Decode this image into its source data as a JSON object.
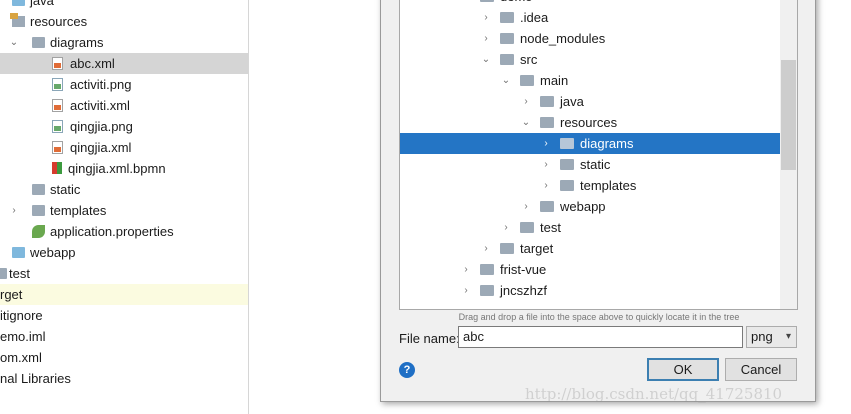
{
  "left_tree": {
    "rows": [
      {
        "label": "java",
        "icon": "folder-blue-icon",
        "arrow": ""
      },
      {
        "label": "resources",
        "icon": "resources-folder-icon",
        "arrow": ""
      },
      {
        "label": "diagrams",
        "icon": "folder-icon",
        "arrow": "⌄"
      },
      {
        "label": "abc.xml",
        "icon": "xml-file-icon",
        "arrow": ""
      },
      {
        "label": "activiti.png",
        "icon": "image-file-icon",
        "arrow": ""
      },
      {
        "label": "activiti.xml",
        "icon": "xml-file-icon",
        "arrow": ""
      },
      {
        "label": "qingjia.png",
        "icon": "image-file-icon",
        "arrow": ""
      },
      {
        "label": "qingjia.xml",
        "icon": "xml-file-icon",
        "arrow": ""
      },
      {
        "label": "qingjia.xml.bpmn",
        "icon": "bpmn-file-icon",
        "arrow": ""
      },
      {
        "label": "static",
        "icon": "folder-icon",
        "arrow": ""
      },
      {
        "label": "templates",
        "icon": "folder-icon",
        "arrow": "›"
      },
      {
        "label": "application.properties",
        "icon": "spring-leaf-icon",
        "arrow": ""
      },
      {
        "label": "webapp",
        "icon": "folder-blue-icon",
        "arrow": ""
      },
      {
        "label": "test",
        "icon": "folder-icon",
        "arrow": ""
      },
      {
        "label": "rget",
        "icon": "",
        "arrow": ""
      },
      {
        "label": "itignore",
        "icon": "",
        "arrow": ""
      },
      {
        "label": "emo.iml",
        "icon": "",
        "arrow": ""
      },
      {
        "label": "om.xml",
        "icon": "",
        "arrow": ""
      },
      {
        "label": "nal Libraries",
        "icon": "",
        "arrow": ""
      }
    ],
    "selected_label": "abc.xml",
    "highlighted_label": "rget"
  },
  "dialog": {
    "tree_rows": [
      {
        "label": "demo",
        "arrow": "⌄"
      },
      {
        "label": ".idea",
        "arrow": "›"
      },
      {
        "label": "node_modules",
        "arrow": "›"
      },
      {
        "label": "src",
        "arrow": "⌄"
      },
      {
        "label": "main",
        "arrow": "⌄"
      },
      {
        "label": "java",
        "arrow": "›"
      },
      {
        "label": "resources",
        "arrow": "⌄"
      },
      {
        "label": "diagrams",
        "arrow": "›"
      },
      {
        "label": "static",
        "arrow": "›"
      },
      {
        "label": "templates",
        "arrow": "›"
      },
      {
        "label": "webapp",
        "arrow": "›"
      },
      {
        "label": "test",
        "arrow": "›"
      },
      {
        "label": "target",
        "arrow": "›"
      },
      {
        "label": "frist-vue",
        "arrow": "›"
      },
      {
        "label": "jncszhzf",
        "arrow": "›"
      }
    ],
    "selected_folder": "diagrams",
    "hint": "Drag and drop a file into the space above to quickly locate it in the tree",
    "file_name_label": "File name:",
    "file_name_value": "abc",
    "extension": "png",
    "ok_label": "OK",
    "cancel_label": "Cancel",
    "help_glyph": "?",
    "accent_color": "#2475c5"
  },
  "watermark": "http://blog.csdn.net/qq_41725810"
}
